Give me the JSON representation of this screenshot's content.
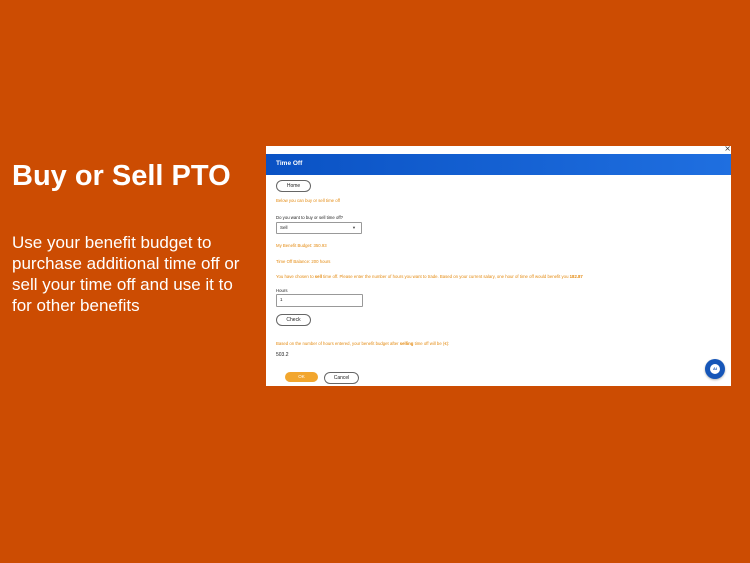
{
  "slide": {
    "title": "Buy or Sell PTO",
    "body": "Use your benefit budget to purchase additional time off or sell your time off and use it to for other benefits"
  },
  "window": {
    "close_glyph": "×",
    "header_title": "Time Off",
    "home_button": "Home",
    "intro_text": "Below you can buy or sell time off",
    "question_label": "Do you want to buy or sell time off?",
    "select_value": "Sell",
    "benefit_budget": "My Benefit Budget: 350.93",
    "time_off_balance": "Time Off Balance: 200 hours",
    "info_prefix": "You have chosen to ",
    "info_bold": "sell",
    "info_suffix": " time off. Please enter the number of hours you want to trade. Based on your current salary, one hour of time off would benefit you ",
    "info_rate": "182.87",
    "hours_label": "Hours",
    "hours_value": "1",
    "check_button": "Check",
    "result_prefix": "Based on the number of hours entered, your benefit budget after ",
    "result_bold": "selling",
    "result_suffix": " time off will be (€):",
    "result_value": "503.2",
    "ok_button": "OK",
    "cancel_button": "Cancel",
    "help_badge": "AI"
  },
  "colors": {
    "background": "#cc4c02",
    "header_blue": "#0a52c4",
    "orange_text": "#e48a10",
    "ok_button": "#f2a62e"
  }
}
